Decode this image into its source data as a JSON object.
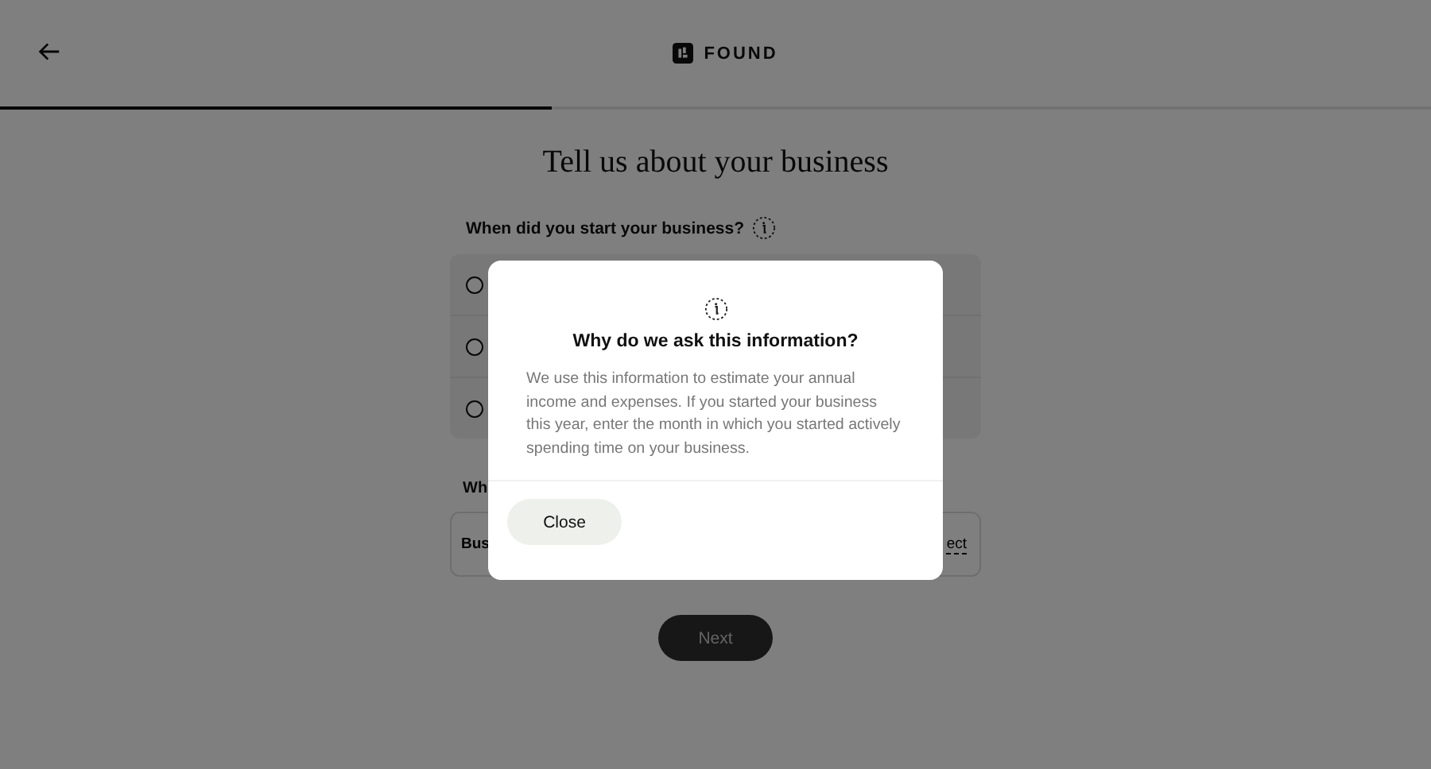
{
  "header": {
    "brand": "FOUND"
  },
  "progress": {
    "level": 0.385
  },
  "title": "Tell us about your business",
  "question_1": {
    "label": "When did you start your business?",
    "options": [
      {
        "selected": false
      },
      {
        "selected": false
      },
      {
        "selected": false
      }
    ]
  },
  "question_2": {
    "label": "Wh",
    "field_text": "Bus",
    "field_action": "ect"
  },
  "next_button": {
    "label": "Next",
    "disabled": true
  },
  "modal": {
    "title": "Why do we ask this information?",
    "body": "We use this information to estimate your annual income and expenses. If you started your business this year, enter the month in which you started actively spending time on your business.",
    "close": "Close"
  }
}
